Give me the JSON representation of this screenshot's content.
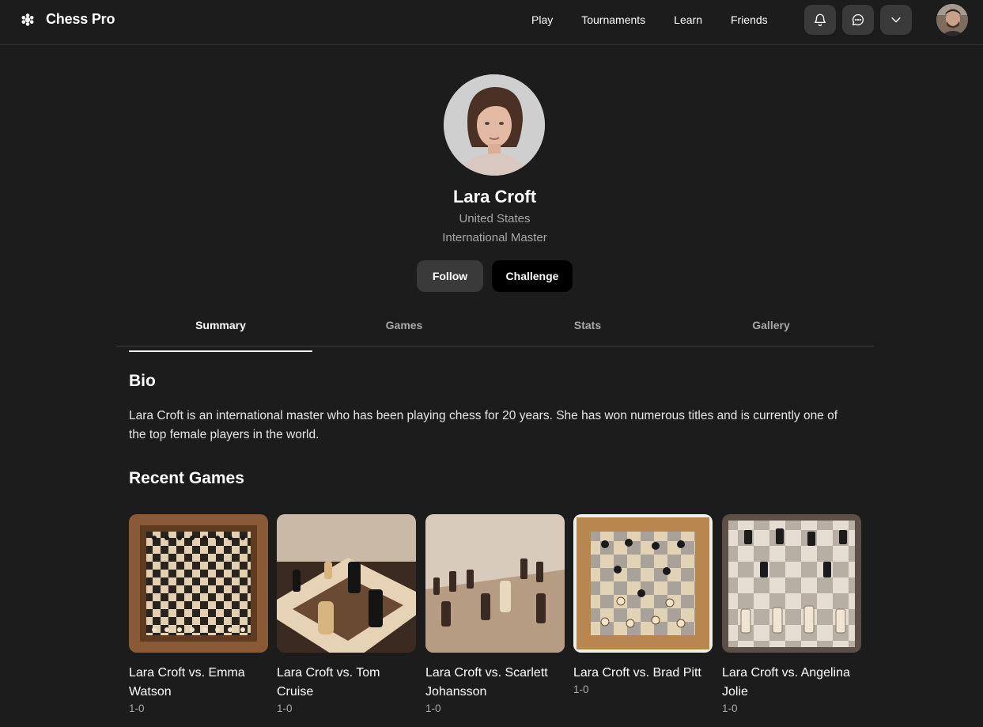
{
  "brand": {
    "name": "Chess Pro",
    "icon": "chess-piece-icon"
  },
  "nav": {
    "items": [
      {
        "label": "Play"
      },
      {
        "label": "Tournaments"
      },
      {
        "label": "Learn"
      },
      {
        "label": "Friends"
      }
    ]
  },
  "header_icons": [
    "bell-icon",
    "chat-icon",
    "chevron-down-icon"
  ],
  "profile": {
    "name": "Lara Croft",
    "country": "United States",
    "title": "International Master",
    "follow_label": "Follow",
    "challenge_label": "Challenge"
  },
  "tabs": [
    {
      "label": "Summary",
      "active": true
    },
    {
      "label": "Games",
      "active": false
    },
    {
      "label": "Stats",
      "active": false
    },
    {
      "label": "Gallery",
      "active": false
    }
  ],
  "bio": {
    "heading": "Bio",
    "text": "Lara Croft is an international master who has been playing chess for 20 years. She has won numerous titles and is currently one of the top female players in the world."
  },
  "recent_games": {
    "heading": "Recent Games",
    "items": [
      {
        "title": "Lara Croft vs. Emma Watson",
        "result": "1-0"
      },
      {
        "title": "Lara Croft vs. Tom Cruise",
        "result": "1-0"
      },
      {
        "title": "Lara Croft vs. Scarlett Johansson",
        "result": "1-0"
      },
      {
        "title": "Lara Croft vs. Brad Pitt",
        "result": "1-0"
      },
      {
        "title": "Lara Croft vs. Angelina Jolie",
        "result": "1-0"
      }
    ]
  },
  "colors": {
    "background": "#1c1c1c",
    "button_secondary": "#3a3a3a",
    "button_primary": "#000000",
    "muted_text": "#a8a8a8"
  }
}
